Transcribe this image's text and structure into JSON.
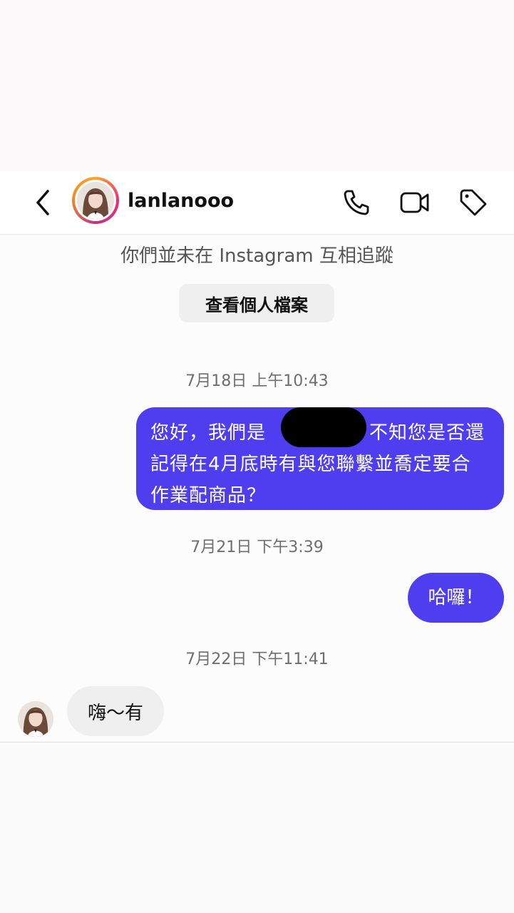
{
  "header": {
    "username": "lanlanooo",
    "icons": [
      "back-chevron-icon",
      "phone-icon",
      "video-icon",
      "tag-icon"
    ]
  },
  "intro": {
    "follow_note": "你們並未在 Instagram 互相追蹤",
    "view_profile_label": "查看個人檔案"
  },
  "messages": [
    {
      "timestamp": "7月18日 上午10:43",
      "direction": "outgoing",
      "text_part1": "您好，我們是",
      "text_part2": "，不知您是否還記得在4月底時有與您聯繫並喬定要合作業配商品？",
      "redacted": true
    },
    {
      "timestamp": "7月21日 下午3:39",
      "direction": "outgoing",
      "text": "哈囉！"
    },
    {
      "timestamp": "7月22日 下午11:41",
      "direction": "incoming",
      "text": "嗨～有"
    }
  ],
  "colors": {
    "outgoing_bubble": "#4f3ef0",
    "incoming_bubble": "#efefef",
    "text_dark": "#111111",
    "text_muted": "#6e6e6e"
  }
}
